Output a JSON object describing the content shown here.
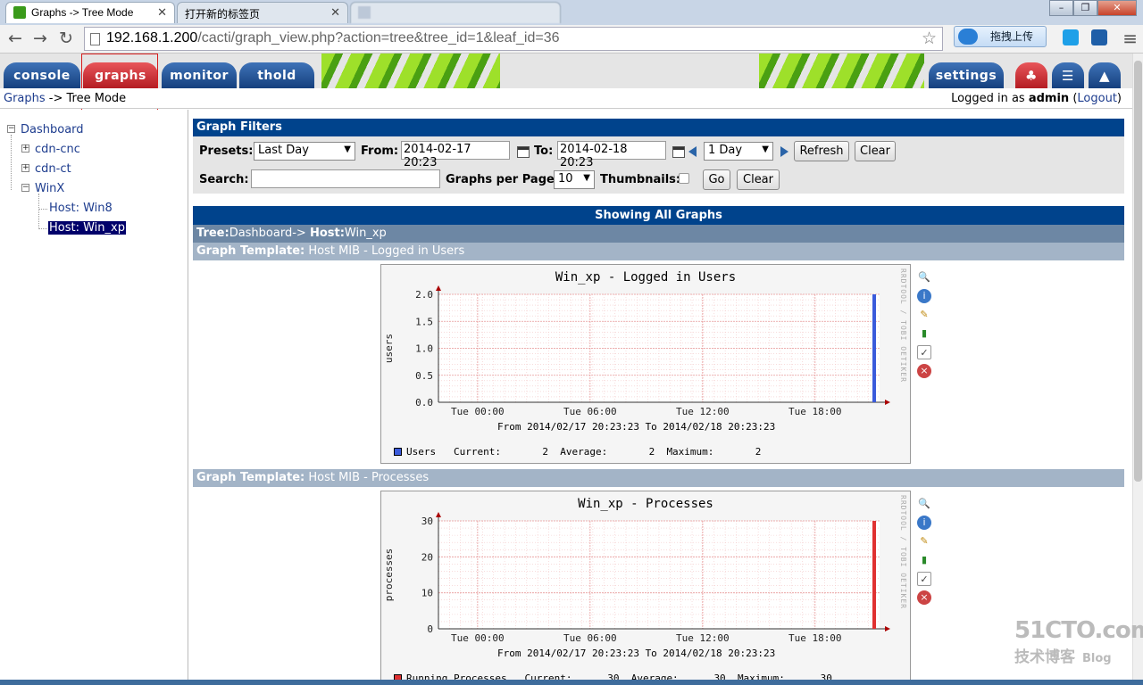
{
  "browser": {
    "tabs": [
      {
        "label": "Graphs -> Tree Mode",
        "active": true
      },
      {
        "label": "打开新的标签页",
        "active": false
      },
      {
        "label": "",
        "active": false
      }
    ],
    "url": {
      "host": "192.168.1.200",
      "path": "/cacti/graph_view.php?action=tree&tree_id=1&leaf_id=36"
    },
    "extension_label": "拖拽上传"
  },
  "cacti": {
    "tabs": [
      "console",
      "graphs",
      "monitor",
      "thold"
    ],
    "right_tabs": [
      "settings"
    ],
    "breadcrumb": {
      "link": "Graphs",
      "sep": " -> ",
      "current": "Tree Mode"
    },
    "login": {
      "prefix": "Logged in as ",
      "user": "admin",
      "open": " (",
      "logout": "Logout",
      "close": ")"
    }
  },
  "tree": {
    "root": "Dashboard",
    "nodes": [
      "cdn-cnc",
      "cdn-ct",
      "WinX"
    ],
    "hosts": [
      "Host: Win8",
      "Host: Win_xp"
    ]
  },
  "filters": {
    "title": "Graph Filters",
    "presets_label": "Presets:",
    "presets_value": "Last Day",
    "from_label": "From:",
    "from_value": "2014-02-17 20:23",
    "to_label": "To:",
    "to_value": "2014-02-18 20:23",
    "span_value": "1 Day",
    "refresh": "Refresh",
    "clear": "Clear",
    "search_label": "Search:",
    "search_value": "",
    "per_page_label": "Graphs per Page:",
    "per_page_value": "10",
    "thumbnails_label": "Thumbnails:",
    "go": "Go",
    "clear2": "Clear"
  },
  "content": {
    "showing": "Showing All Graphs",
    "tree_row": {
      "k1": "Tree:",
      "v1": "Dashboard-> ",
      "k2": "Host:",
      "v2": "Win_xp"
    },
    "graphs": [
      {
        "template_label": "Graph Template:",
        "template_name": " Host MIB - Logged in Users",
        "title": "Win_xp - Logged in Users",
        "ylabel": "users",
        "yticks": [
          "2.0",
          "1.5",
          "1.0",
          "0.5",
          "0.0"
        ],
        "xticks": [
          "Tue 00:00",
          "Tue 06:00",
          "Tue 12:00",
          "Tue 18:00"
        ],
        "range_text": "From 2014/02/17 20:23:23 To 2014/02/18 20:23:23",
        "legend": {
          "name": "Users",
          "current_label": "Current:",
          "current": "2",
          "average_label": "Average:",
          "average": "2",
          "maximum_label": "Maximum:",
          "maximum": "2",
          "color": "#3b5bdb"
        },
        "side_text": "RRDTOOL / TOBI OETIKER"
      },
      {
        "template_label": "Graph Template:",
        "template_name": " Host MIB - Processes",
        "title": "Win_xp - Processes",
        "ylabel": "processes",
        "yticks": [
          "30",
          "20",
          "10",
          "0"
        ],
        "xticks": [
          "Tue 00:00",
          "Tue 06:00",
          "Tue 12:00",
          "Tue 18:00"
        ],
        "range_text": "From 2014/02/17 20:23:23 To 2014/02/18 20:23:23",
        "legend": {
          "name": "Running Processes",
          "current_label": "Current:",
          "current": "30",
          "average_label": "Average:",
          "average": "30",
          "maximum_label": "Maximum:",
          "maximum": "30",
          "color": "#e03131"
        },
        "side_text": "RRDTOOL / TOBI OETIKER"
      }
    ]
  },
  "watermark": {
    "brand": "51CTO.com",
    "sub": "技术博客",
    "blog": "Blog"
  },
  "colors": {
    "accent": "#00438c",
    "tab_blue": "#15407e",
    "tab_red": "#b41c22",
    "stripe_green": "#9ee02a"
  }
}
